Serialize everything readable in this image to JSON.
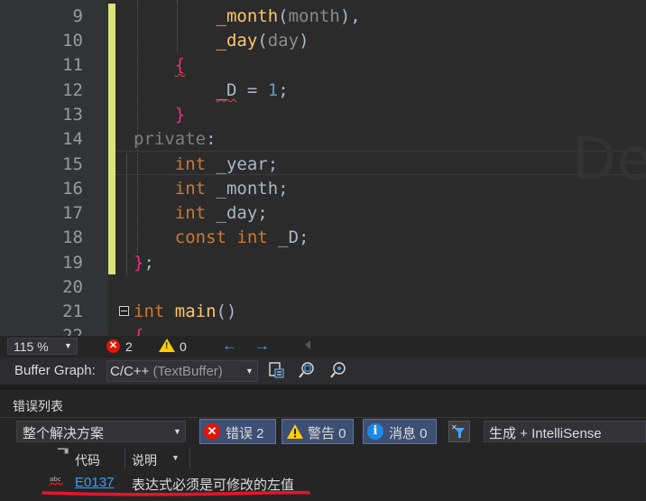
{
  "editor": {
    "lines": [
      {
        "num": "9"
      },
      {
        "num": "10"
      },
      {
        "num": "11"
      },
      {
        "num": "12"
      },
      {
        "num": "13"
      },
      {
        "num": "14"
      },
      {
        "num": "15"
      },
      {
        "num": "16"
      },
      {
        "num": "17"
      },
      {
        "num": "18"
      },
      {
        "num": "19"
      },
      {
        "num": "20"
      },
      {
        "num": "21"
      },
      {
        "num": "22"
      }
    ],
    "watermark": "De"
  },
  "status": {
    "zoom": "115 %",
    "error_count": "2",
    "warning_count": "0"
  },
  "buffer_graph": {
    "label": "Buffer Graph:",
    "value": "C/C++",
    "value_sub": "(TextBuffer)"
  },
  "error_list": {
    "title": "错误列表",
    "scope": "整个解决方案",
    "errors_label": "错误 2",
    "warnings_label": "警告 0",
    "messages_label": "消息 0",
    "build_filter": "生成 + IntelliSense",
    "columns": {
      "code": "代码",
      "description": "说明"
    },
    "rows": [
      {
        "code": "E0137",
        "description": "表达式必须是可修改的左值"
      }
    ]
  },
  "colors": {
    "keyword": "#cc7832",
    "function": "#ffc66d",
    "number": "#6897bb",
    "brace": "#e8327a",
    "error_link": "#3aa0ff",
    "error_red": "#e51400"
  }
}
